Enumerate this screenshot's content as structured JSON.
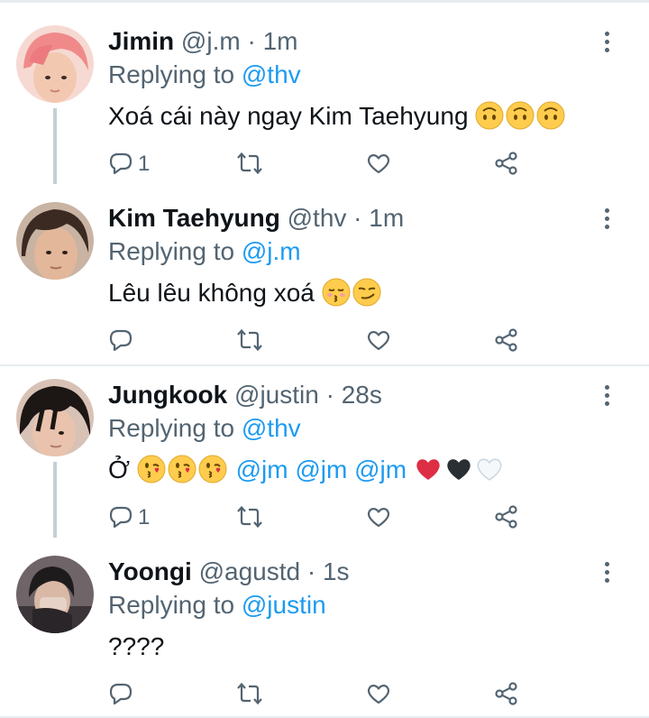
{
  "tweets": [
    {
      "name": "Jimin",
      "handle": "@j.m",
      "time": "1m",
      "replying_prefix": "Replying to",
      "replying_to": "@thv",
      "text": "Xoá cái này ngay Kim Taehyung",
      "emojis": [
        "upside-down-face",
        "upside-down-face",
        "upside-down-face"
      ],
      "reply_count": "1",
      "avatar": {
        "hair": "#f08a8a",
        "skin": "#f3c8b0",
        "bg": "#f6d9d2"
      }
    },
    {
      "name": "Kim Taehyung",
      "handle": "@thv",
      "time": "1m",
      "replying_prefix": "Replying to",
      "replying_to": "@j.m",
      "text": "Lêu lêu không xoá",
      "emojis": [
        "kissing-closed-eyes",
        "smirking-face"
      ],
      "reply_count": "",
      "avatar": {
        "hair": "#3b2a22",
        "skin": "#e2b79a",
        "bg": "#c9b3a2"
      }
    },
    {
      "name": "Jungkook",
      "handle": "@justin",
      "time": "28s",
      "replying_prefix": "Replying to",
      "replying_to": "@thv",
      "text_prefix": "Ở",
      "emojis_a": [
        "face-blowing-kiss",
        "face-blowing-kiss",
        "face-blowing-kiss"
      ],
      "mentions": [
        "@jm",
        "@jm",
        "@jm"
      ],
      "hearts": [
        "red-heart",
        "black-heart",
        "white-heart"
      ],
      "reply_count": "1",
      "avatar": {
        "hair": "#1c1614",
        "skin": "#e9c3ad",
        "bg": "#d8c2b6"
      }
    },
    {
      "name": "Yoongi",
      "handle": "@agustd",
      "time": "1s",
      "replying_prefix": "Replying to",
      "replying_to": "@justin",
      "text": "????",
      "reply_count": "",
      "avatar": {
        "hair": "#1e1b1d",
        "skin": "#d9b8a6",
        "bg": "#6f6468"
      }
    }
  ],
  "separator": " · ",
  "colors": {
    "accent": "#1d9bf0",
    "muted": "#536471",
    "text": "#0f1419",
    "divider": "#e6ecf0"
  },
  "icons": [
    "reply-icon",
    "retweet-icon",
    "like-icon",
    "share-icon",
    "more-options-icon"
  ]
}
